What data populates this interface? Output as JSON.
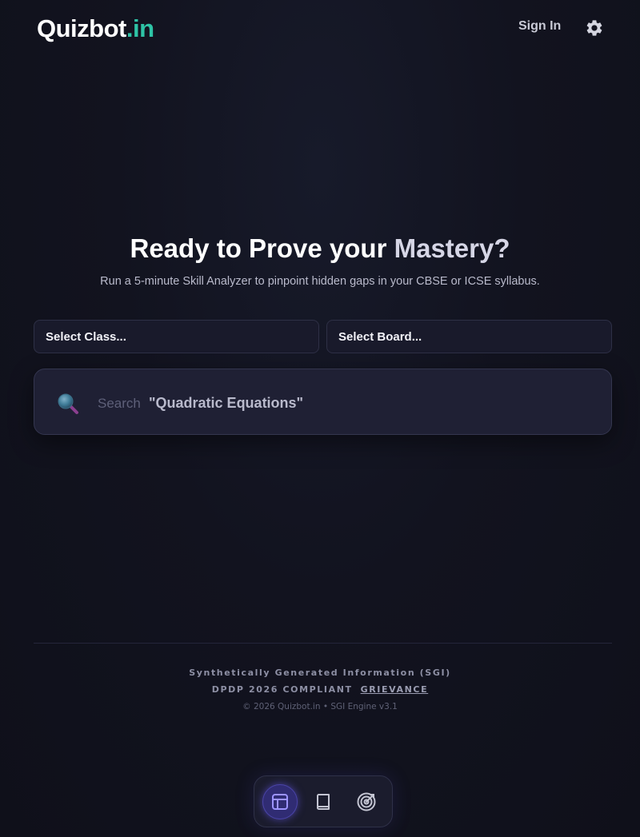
{
  "header": {
    "logo_main": "Quizbot",
    "logo_suffix": ".in",
    "signin_label": "Sign In",
    "settings_icon": "gear-icon"
  },
  "hero": {
    "title_main": "Ready to Prove your ",
    "title_accent": "Mastery?",
    "subtitle": "Run a 5-minute Skill Analyzer to pinpoint hidden gaps in your CBSE or ICSE syllabus."
  },
  "filters": {
    "class_label": "Select Class...",
    "board_label": "Select Board..."
  },
  "search": {
    "icon": "search-icon",
    "placeholder": "Search",
    "example": "\"Quadratic Equations\""
  },
  "footer": {
    "line1": "Synthetically Generated Information (SGI)",
    "line2": "DPDP 2026 COMPLIANT",
    "grievance": "GRIEVANCE",
    "line3": "© 2026 Quizbot.in • SGI Engine v3.1"
  },
  "nav": {
    "items": [
      {
        "icon": "dashboard-icon",
        "active": true
      },
      {
        "icon": "book-icon",
        "active": false
      },
      {
        "icon": "target-icon",
        "active": false
      }
    ]
  },
  "colors": {
    "accent": "#2ec4a6",
    "nav_active": "#302c73",
    "background": "#12131f"
  }
}
